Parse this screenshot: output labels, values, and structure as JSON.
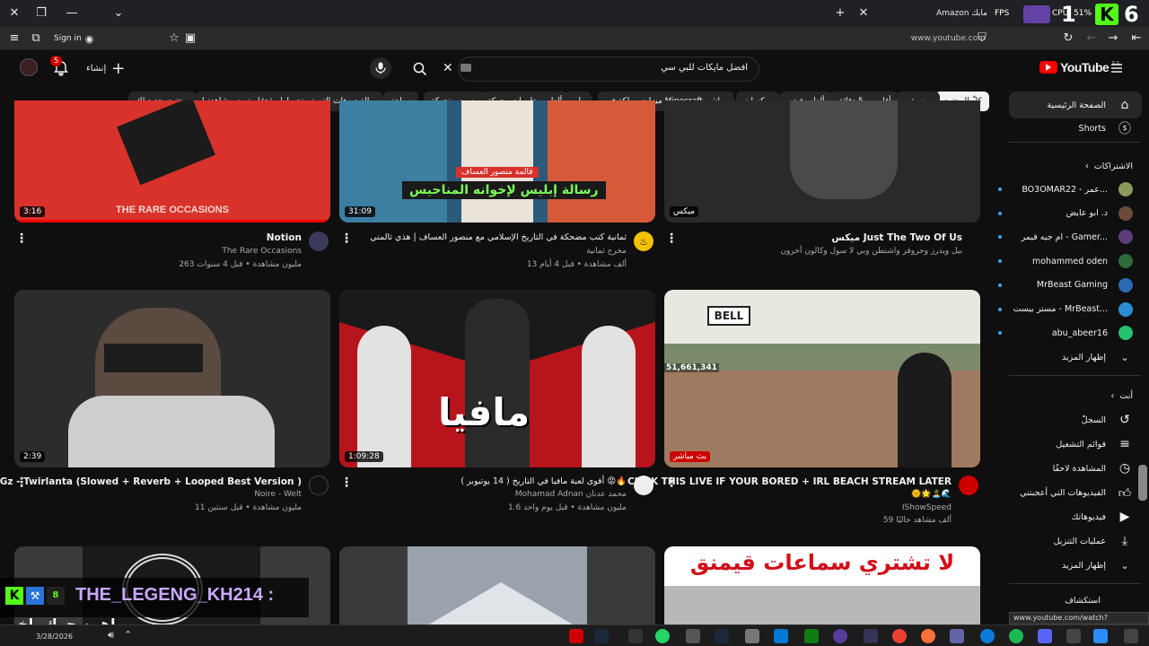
{
  "browser": {
    "tab_title": "Amazon مايك",
    "signin_label": "Sign in",
    "url": "www.youtube.com",
    "status_url": "www.youtube.com/watch?v=um1YFRYc_P4",
    "overlay_numbers": {
      "fps": "FPS",
      "cpu": "CPU",
      "pct": "51%",
      "one": "1",
      "six": "6"
    }
  },
  "header": {
    "logo_text": "YouTube",
    "logo_region": "SA",
    "search_query": "افضل مايكات للبي سي",
    "create_label": "إنشاء",
    "notif_count": "5"
  },
  "chips": [
    {
      "label": "كلّ المحتوى",
      "active": true
    },
    {
      "label": "موسيقى",
      "active": false
    },
    {
      "label": "أقل من 5 دقائق",
      "active": false
    },
    {
      "label": "ألعاب فيديو",
      "active": false
    },
    {
      "label": "ميكسات",
      "active": false
    },
    {
      "label": "مباشر",
      "active": false
    },
    {
      "label": "ميزات مملكة في Minecraft",
      "active": false
    },
    {
      "label": "راب",
      "active": false
    },
    {
      "label": "ألعاب مغامرات وحركة",
      "active": false
    },
    {
      "label": "رسوم متحركة",
      "active": false
    },
    {
      "label": "سياحة",
      "active": false
    },
    {
      "label": "طهي",
      "active": false
    },
    {
      "label": "الفيديوهات التي تم تحميلها مؤخرًا",
      "active": false
    },
    {
      "label": "تمت مشاهدتها",
      "active": false
    },
    {
      "label": "محتوى جديد لك",
      "active": false
    }
  ],
  "sidebar": {
    "home": "الصفحة الرئيسية",
    "shorts": "Shorts",
    "subs_header": "الاشتراكات",
    "subs": [
      {
        "label": "BO3OMAR22 - عمر...",
        "color": "#8a9a5b"
      },
      {
        "label": "د. ابو عايض",
        "color": "#6b4b3a"
      },
      {
        "label": "ام جيه قيمر - Gamer...",
        "color": "#5a3d7a"
      },
      {
        "label": "mohammed oden",
        "color": "#2e6b3a"
      },
      {
        "label": "MrBeast Gaming",
        "color": "#2b6bb5"
      },
      {
        "label": "مستر بيست - MrBeast...",
        "color": "#2b8fd6"
      },
      {
        "label": "abu_abeer16",
        "color": "#25c16f"
      }
    ],
    "show_more": "إظهار المزيد",
    "you_header": "أنت",
    "you_items": [
      "السجلّ",
      "قوائم التشغيل",
      "المشاهدة لاحقًا",
      "الفيديوهات التي أعجبتني",
      "فيديوهاتك",
      "عمليات التنزيل"
    ],
    "show_more2": "إظهار المزيد",
    "explore": "استكشاف"
  },
  "videos": [
    {
      "title": "Notion",
      "channel": "The Rare Occasions",
      "meta": "263 مليون مشاهدة • قبل 4 سنوات",
      "duration": "3:16",
      "thumb_text": "THE RARE OCCASIONS"
    },
    {
      "title": "ثمانية كتب مضحكة في التاريخ الإسلامي مع منصور العساف | هذي ثالمتي",
      "channel": "مخرج ثمانية",
      "meta": "13 ألف مشاهدة • قبل 4 أيام",
      "duration": "31:09",
      "thumb_text": "رسالة إبليس لإخوانه المناحيس",
      "thumb_sub": "قالمة منصور العساف"
    },
    {
      "title": "ميكس Just The Two Of Us",
      "channel": "بيل ويذرز وجروفر واشنطن وبي لا سول وكالون آخرون",
      "meta": "",
      "duration": "ميكس",
      "thumb_text": ""
    },
    {
      "title": "22Gz - Twirlanta (Slowed + Reverb + Looped Best Version )",
      "channel": "Noire - Welt",
      "meta": "11 مليون مشاهدة • قبل سنتين",
      "duration": "2:39",
      "thumb_text": ""
    },
    {
      "title": "أقوى لعبة مافيا في التاريخ ( 14 يوتيوبر ) 😡🔥",
      "channel": "Mohamad Adnan محمد عدنان",
      "meta": "1.6 مليون مشاهدة • قبل يوم واحد",
      "duration": "1:09:28",
      "thumb_text": "مافيا"
    },
    {
      "title": "CLICK THIS LIVE IF YOUR BORED + IRL BEACH STREAM LATER",
      "channel": "IShowSpeed",
      "meta": "59 ألف مشاهد حاليًا",
      "duration": "بث مباشر",
      "thumb_text": "51,661,341",
      "extra": "🌞🌟🏝️🌊"
    },
    {
      "title": "",
      "channel": "",
      "meta": "",
      "duration": "",
      "thumb_text": ""
    },
    {
      "title": "",
      "channel": "",
      "meta": "",
      "duration": "",
      "thumb_text": ""
    },
    {
      "title": "",
      "channel": "",
      "meta": "",
      "duration": "",
      "thumb_text": "لا تشتري سماعات قيمنق"
    }
  ],
  "overlay": {
    "username": "THE_LEGENG_KH214 :",
    "message": "اهين جوك ياخي",
    "date": "3/28/2026"
  },
  "colors": {
    "accent": "#ff0000",
    "chat_name": "#c9a8ff",
    "live": "#cc0000"
  }
}
